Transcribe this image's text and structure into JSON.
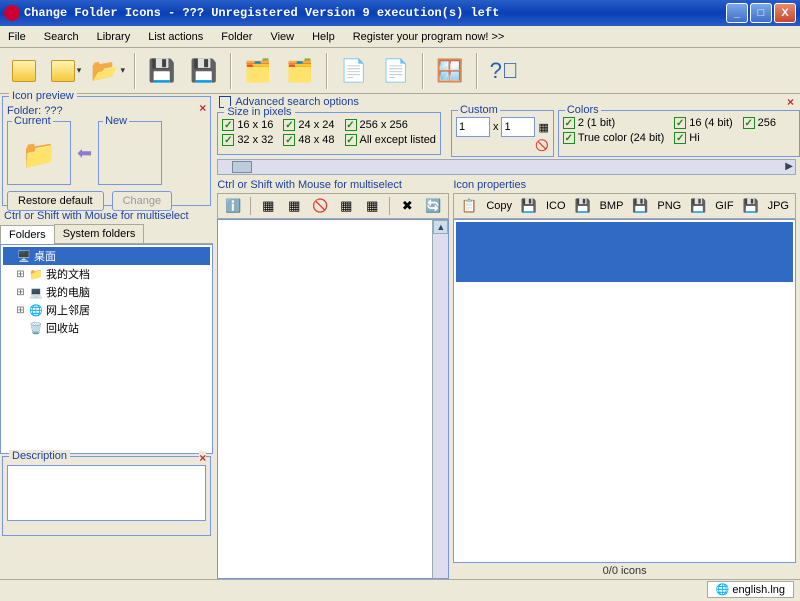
{
  "title": "Change Folder Icons - ??? Unregistered Version 9 execution(s) left",
  "menu": {
    "file": "File",
    "search": "Search",
    "library": "Library",
    "list": "List actions",
    "folder": "Folder",
    "view": "View",
    "help": "Help",
    "register": "Register your program now! >>"
  },
  "preview": {
    "groupLabel": "Icon preview",
    "folderLabel": "Folder: ???",
    "current": "Current",
    "new": "New",
    "restore": "Restore default",
    "change": "Change"
  },
  "multiselect": "Ctrl or Shift with Mouse for multiselect",
  "tabs": {
    "folders": "Folders",
    "system": "System folders"
  },
  "tree": {
    "desktop": "桌面",
    "docs": "我的文档",
    "computer": "我的电脑",
    "network": "网上邻居",
    "recycle": "回收站"
  },
  "description": "Description",
  "advanced": "Advanced search options",
  "sizes": {
    "label": "Size in pixels",
    "s16": "16 x 16",
    "s24": "24 x 24",
    "s32": "32 x 32",
    "s48": "48 x 48",
    "s256": "256 x 256",
    "all": "All except listed"
  },
  "custom": {
    "label": "Custom",
    "v1": "1",
    "x": "x",
    "v2": "1"
  },
  "colors": {
    "label": "Colors",
    "c2": "2 (1 bit)",
    "c16": "16 (4 bit)",
    "c256": "256",
    "ctrue": "True color (24 bit)",
    "chi": "Hi"
  },
  "iconprops": "Icon properties",
  "pt": {
    "copy": "Copy",
    "ico": "ICO",
    "bmp": "BMP",
    "png": "PNG",
    "gif": "GIF",
    "jpg": "JPG"
  },
  "count": "0/0 icons",
  "lang": "english.lng"
}
